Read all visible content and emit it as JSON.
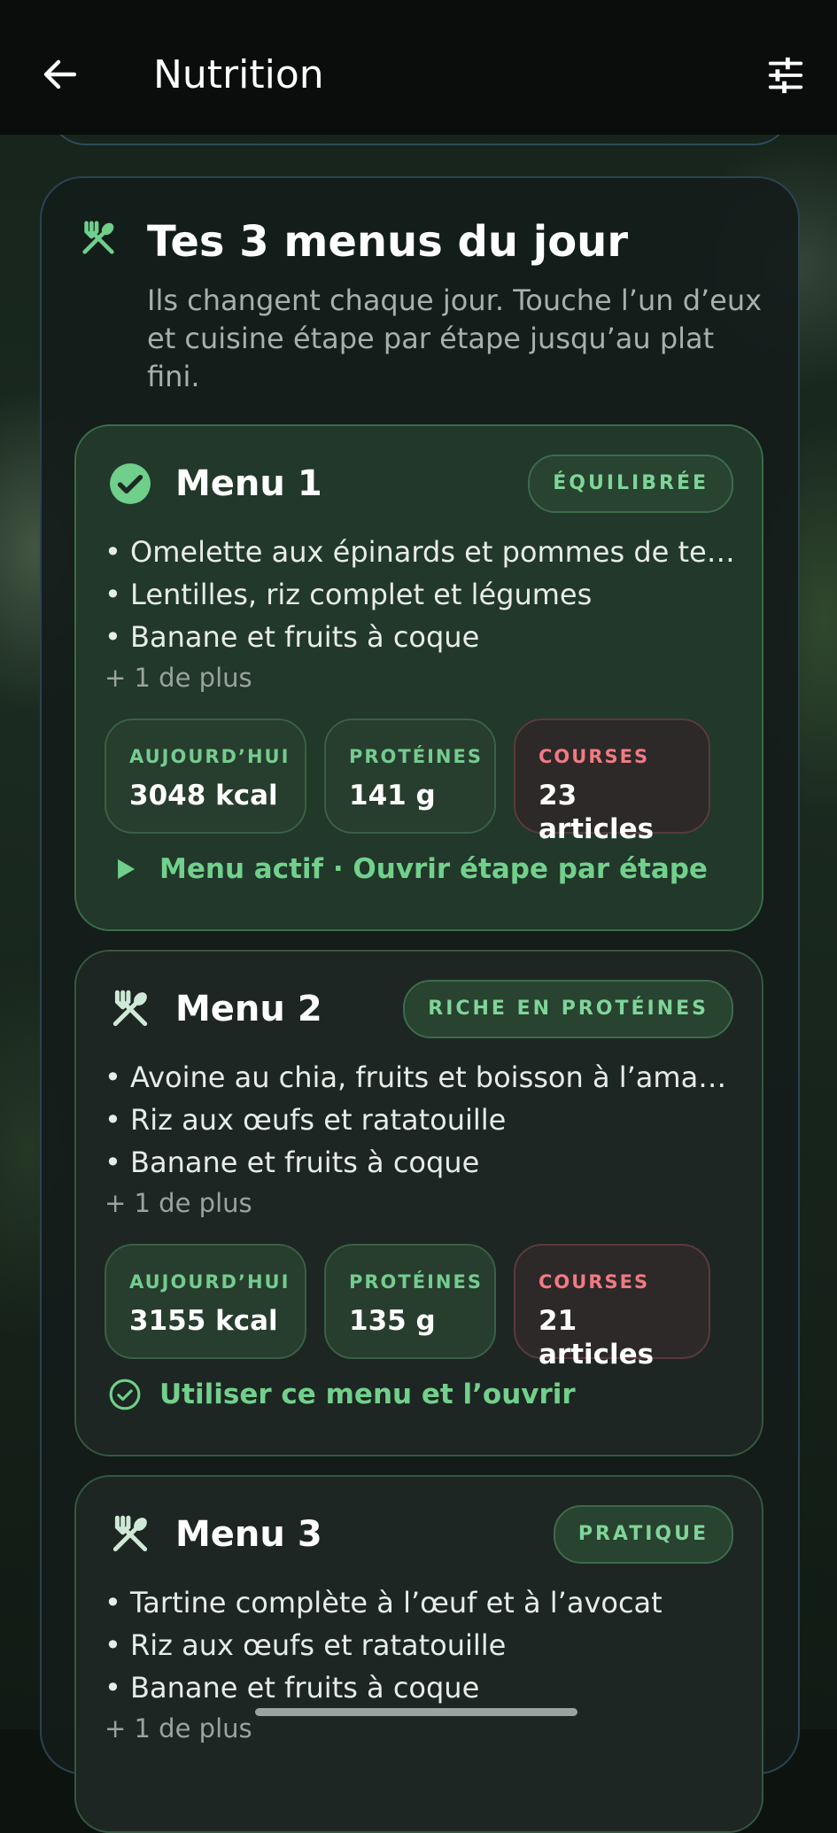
{
  "appbar": {
    "back_icon": "arrow-left-icon",
    "title": "Nutrition",
    "filter_icon": "tune-sliders-icon"
  },
  "section": {
    "icon": "fork-spoon-icon",
    "title": "Tes 3 menus du jour",
    "subtitle": "Ils changent chaque jour. Touche l’un d’eux et cuisine étape par étape jusqu’au plat fini."
  },
  "menus": [
    {
      "title": "Menu 1",
      "icon": "check-circle-icon",
      "badge": "ÉQUILIBRÉE",
      "items": [
        "• Omelette aux épinards et pommes de terre",
        "• Lentilles, riz complet et légumes",
        "• Banane et fruits à coque"
      ],
      "more": "+ 1 de plus",
      "stats": [
        {
          "label": "AUJOURD’HUI",
          "value": "3048 kcal"
        },
        {
          "label": "PROTÉINES",
          "value": "141 g"
        },
        {
          "label": "COURSES",
          "value": "23 articles"
        }
      ],
      "action_icon": "play-icon",
      "action": "Menu actif · Ouvrir étape par étape"
    },
    {
      "title": "Menu 2",
      "icon": "fork-spoon-icon",
      "badge": "RICHE EN PROTÉINES",
      "items": [
        "• Avoine au chia, fruits et boisson à l’amande",
        "• Riz aux œufs et ratatouille",
        "• Banane et fruits à coque"
      ],
      "more": "+ 1 de plus",
      "stats": [
        {
          "label": "AUJOURD’HUI",
          "value": "3155 kcal"
        },
        {
          "label": "PROTÉINES",
          "value": "135 g"
        },
        {
          "label": "COURSES",
          "value": "21 articles"
        }
      ],
      "action_icon": "check-circle-outline-icon",
      "action": "Utiliser ce menu et l’ouvrir"
    },
    {
      "title": "Menu 3",
      "icon": "fork-spoon-icon",
      "badge": "PRATIQUE",
      "items": [
        "• Tartine complète à l’œuf et à l’avocat",
        "• Riz aux œufs et ratatouille",
        "• Banane et fruits à coque"
      ],
      "more": "+ 1 de plus"
    }
  ],
  "colors": {
    "accent": "#72d08c",
    "courses": "#f07a84",
    "background": "#0a0d0b"
  }
}
